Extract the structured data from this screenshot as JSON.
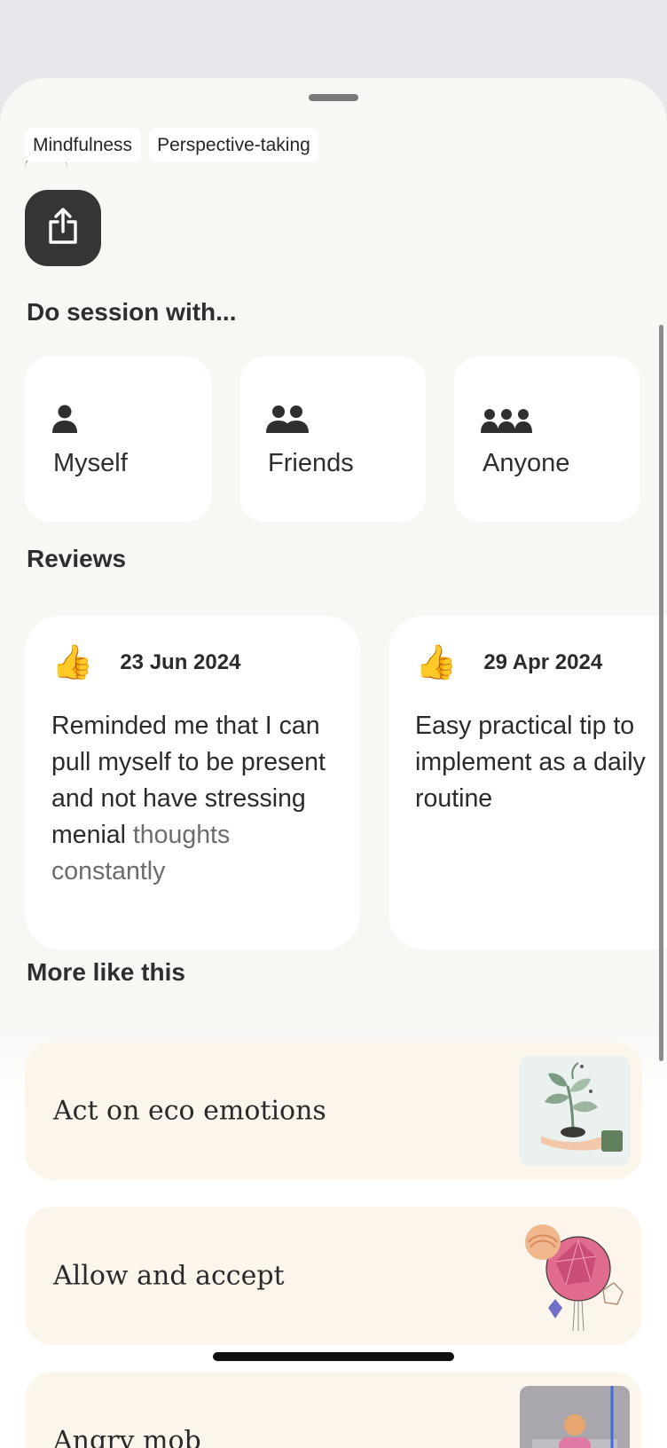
{
  "tags": [
    "Mindfulness",
    "Perspective-taking"
  ],
  "share": {
    "icon": "share-icon"
  },
  "session": {
    "title": "Do session with...",
    "options": [
      {
        "label": "Myself",
        "icon": "person-icon"
      },
      {
        "label": "Friends",
        "icon": "two-people-icon"
      },
      {
        "label": "Anyone",
        "icon": "group-icon"
      }
    ]
  },
  "reviews": {
    "title": "Reviews",
    "items": [
      {
        "emoji": "👍",
        "date": "23 Jun 2024",
        "text": "Reminded me that I can pull myself to be present and not have stressing menial",
        "text_faded": "thoughts constantly"
      },
      {
        "emoji": "👍",
        "date": "29 Apr 2024",
        "text": "Easy practical tip to implement as a daily routine",
        "text_faded": ""
      }
    ]
  },
  "more": {
    "title": "More like this",
    "items": [
      {
        "title": "Act on eco emotions"
      },
      {
        "title": "Allow and accept"
      },
      {
        "title": "Angry mob"
      }
    ]
  }
}
